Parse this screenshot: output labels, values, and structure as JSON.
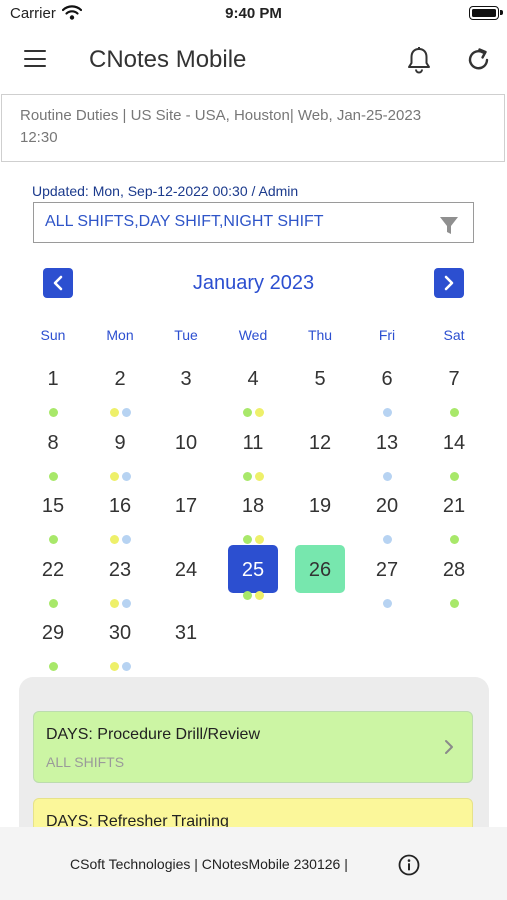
{
  "status_bar": {
    "carrier": "Carrier",
    "time": "9:40 PM"
  },
  "header": {
    "title": "CNotes Mobile"
  },
  "context": {
    "line1": "Routine Duties | US Site - USA, Houston| Web, Jan-25-2023",
    "line2": "12:30"
  },
  "updated": "Updated: Mon, Sep-12-2022 00:30 / Admin",
  "filter": {
    "value": "ALL SHIFTS,DAY SHIFT,NIGHT SHIFT"
  },
  "calendar": {
    "month_label": "January 2023",
    "weekdays": [
      "Sun",
      "Mon",
      "Tue",
      "Wed",
      "Thu",
      "Fri",
      "Sat"
    ],
    "days": [
      "1",
      "2",
      "3",
      "4",
      "5",
      "6",
      "7",
      "8",
      "9",
      "10",
      "11",
      "12",
      "13",
      "14",
      "15",
      "16",
      "17",
      "18",
      "19",
      "20",
      "21",
      "22",
      "23",
      "24",
      "25",
      "26",
      "27",
      "28",
      "29",
      "30",
      "31"
    ],
    "today": "25",
    "selected": "26",
    "dot_colors": {
      "green": "#a8e86a",
      "yellow": "#eef06a",
      "blue": "#b7d3f2"
    }
  },
  "tasks": [
    {
      "title": "DAYS: Procedure Drill/Review",
      "subtitle": "ALL SHIFTS",
      "color": "#ccf5a4"
    },
    {
      "title": "DAYS: Refresher Training",
      "subtitle": "",
      "color": "#fbf79a"
    }
  ],
  "footer": {
    "text": "CSoft Technologies | CNotesMobile  230126 |"
  },
  "colors": {
    "accent": "#2c4fd0",
    "today_bg": "#2c4fd0",
    "selected_bg": "#77e7ae"
  }
}
